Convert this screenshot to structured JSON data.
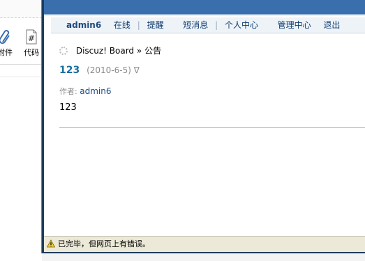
{
  "background_editor": {
    "tools": [
      {
        "label": "附件",
        "icon": "paperclip-icon"
      },
      {
        "label": "代码",
        "icon": "code-hash-icon"
      }
    ]
  },
  "navbar": {
    "username": "admin6",
    "status": "在线",
    "items": [
      "提醒",
      "短消息",
      "个人中心",
      "管理中心",
      "退出"
    ]
  },
  "breadcrumb": {
    "site": "Discuz! Board",
    "separator": "»",
    "current": "公告"
  },
  "post": {
    "subject": "123",
    "date": "(2010-6-5)",
    "toggle": "∇",
    "author_label": "作者:",
    "author": "admin6",
    "body": "123"
  },
  "statusbar": {
    "text": "已完毕，但网页上有错误。",
    "icon": "warning-icon"
  },
  "colors": {
    "top_band": "#3a6fad",
    "navbar_bg": "#eef3f8",
    "link": "#1f4a7d",
    "subject": "#1a6fa0",
    "statusbar_bg": "#ece9d8"
  }
}
